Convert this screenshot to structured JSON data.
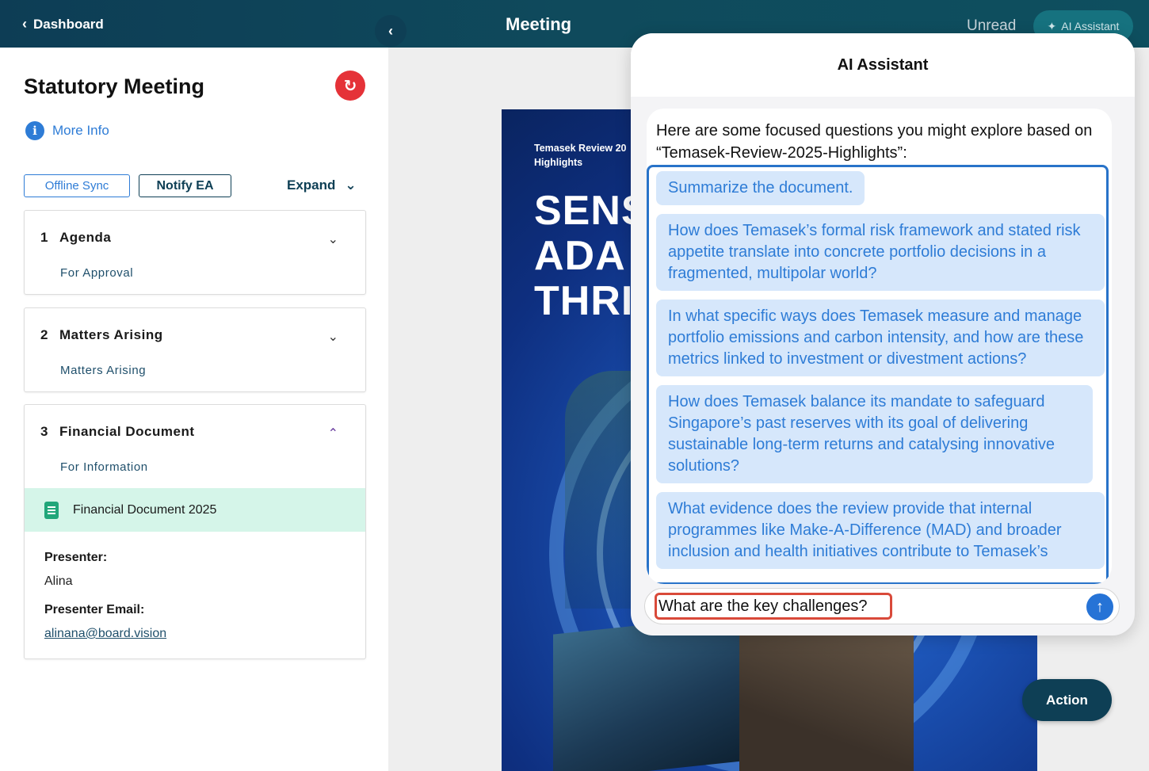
{
  "topbar": {
    "back_label": "Dashboard",
    "title": "Meeting",
    "unread_label": "Unread",
    "ai_button_label": "AI Assistant"
  },
  "meeting": {
    "title": "Statutory Meeting",
    "more_info": "More Info",
    "offline_sync": "Offline Sync",
    "notify_ea": "Notify EA",
    "expand": "Expand"
  },
  "agenda": [
    {
      "number": "1",
      "title": "Agenda",
      "subtitle": "For Approval"
    },
    {
      "number": "2",
      "title": "Matters Arising",
      "subtitle": "Matters Arising"
    },
    {
      "number": "3",
      "title": "Financial Document",
      "subtitle": "For Information",
      "document": "Financial Document 2025",
      "presenter_label": "Presenter:",
      "presenter": "Alina",
      "presenter_email_label": "Presenter Email:",
      "presenter_email": "alinana@board.vision"
    }
  ],
  "document": {
    "small_title": "Temasek Review 20\nHighlights",
    "big_title": "SENS\nADA\nTHRI"
  },
  "action_label": "Action",
  "ai": {
    "title": "AI Assistant",
    "intro": "Here are some focused questions you might explore based on “Temasek-Review-2025-Highlights”:",
    "questions": [
      "Summarize the document.",
      "How does Temasek’s formal risk framework and stated risk appetite translate into concrete portfolio decisions in a fragmented, multipolar world?",
      "In what specific ways does Temasek measure and manage portfolio emissions and carbon intensity, and how are these metrics linked to investment or divestment actions?",
      "How does Temasek balance its mandate to safeguard Singapore’s past reserves with its goal of delivering sustainable long-term returns and catalysing innovative solutions?",
      "What evidence does the review provide that internal programmes like Make-A-Difference (MAD) and broader inclusion and health initiatives contribute to Temasek’s"
    ],
    "input_value": "What are the key challenges?"
  },
  "colors": {
    "topbar": "#0e4a5c",
    "accent_blue": "#2e7cd6",
    "refresh_red": "#e53238",
    "doc_highlight": "#d5f5e9"
  }
}
